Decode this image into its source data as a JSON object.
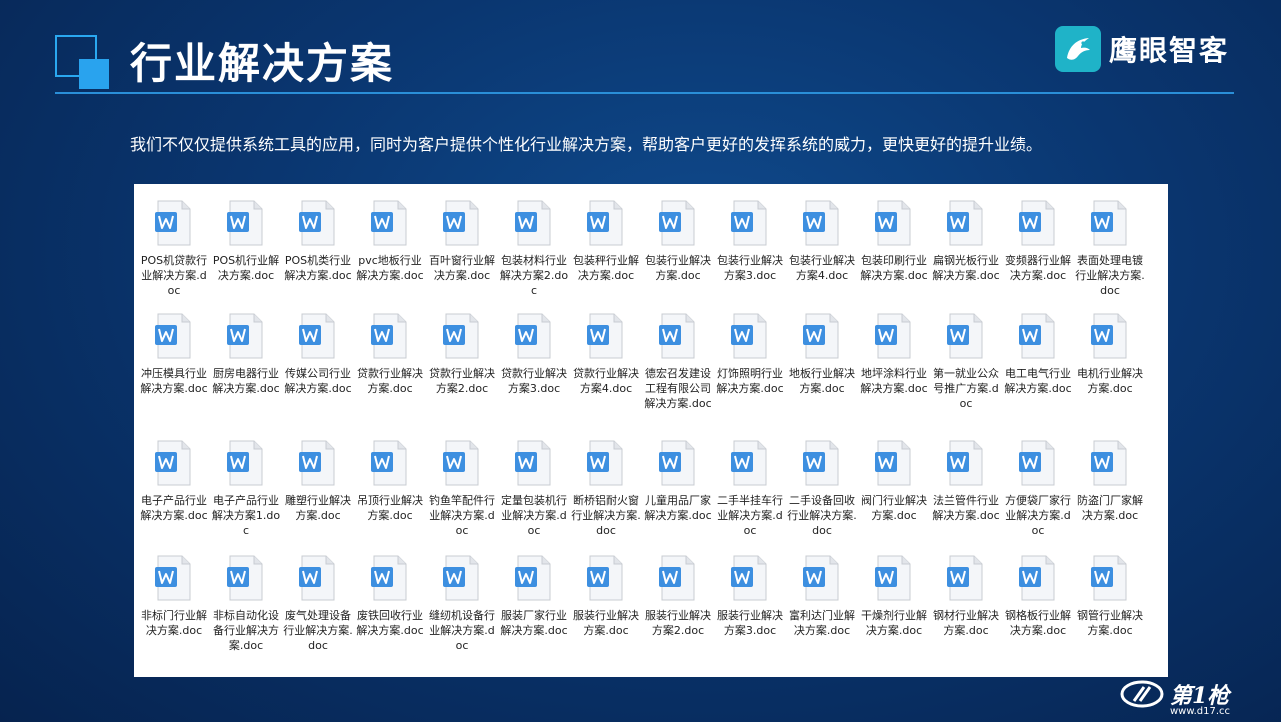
{
  "slide": {
    "title": "行业解决方案",
    "intro": "我们不仅仅提供系统工具的应用，同时为客户提供个性化行业解决方案，帮助客户更好的发挥系统的威力，更快更好的提升业绩。"
  },
  "brand": {
    "name": "鹰眼智客",
    "icon": "eagle-logo-icon",
    "color": "#1fb3c8"
  },
  "watermark": {
    "text": "第1枪",
    "url": "www.d17.cc"
  },
  "colors": {
    "accent": "#2aa8f0",
    "doc_icon": "#3d8fe0"
  },
  "files": [
    [
      "POS机贷款行业解决方案.doc",
      "POS机行业解决方案.doc",
      "POS机类行业解决方案.doc",
      "pvc地板行业解决方案.doc",
      "百叶窗行业解决方案.doc",
      "包装材料行业解决方案2.doc",
      "包装秤行业解决方案.doc",
      "包装行业解决方案.doc",
      "包装行业解决方案3.doc",
      "包装行业解决方案4.doc",
      "包装印刷行业解决方案.doc",
      "扁钢光板行业解决方案.doc",
      "变频器行业解决方案.doc",
      "表面处理电镀行业解决方案.doc"
    ],
    [
      "冲压模具行业解决方案.doc",
      "厨房电器行业解决方案.doc",
      "传媒公司行业解决方案.doc",
      "贷款行业解决方案.doc",
      "贷款行业解决方案2.doc",
      "贷款行业解决方案3.doc",
      "贷款行业解决方案4.doc",
      "德宏召发建设工程有限公司解决方案.doc",
      "灯饰照明行业解决方案.doc",
      "地板行业解决方案.doc",
      "地坪涂料行业解决方案.doc",
      "第一就业公众号推广方案.doc",
      "电工电气行业解决方案.doc",
      "电机行业解决方案.doc"
    ],
    [
      "电子产品行业解决方案.doc",
      "电子产品行业解决方案1.doc",
      "雕塑行业解决方案.doc",
      "吊顶行业解决方案.doc",
      "钓鱼竿配件行业解决方案.doc",
      "定量包装机行业解决方案.doc",
      "断桥铝耐火窗行业解决方案.doc",
      "儿童用品厂家解决方案.doc",
      "二手半挂车行业解决方案.doc",
      "二手设备回收行业解决方案.doc",
      "阀门行业解决方案.doc",
      "法兰管件行业解决方案.doc",
      "方便袋厂家行业解决方案.doc",
      "防盗门厂家解决方案.doc"
    ],
    [
      "非标门行业解决方案.doc",
      "非标自动化设备行业解决方案.doc",
      "废气处理设备行业解决方案.doc",
      "废铁回收行业解决方案.doc",
      "缝纫机设备行业解决方案.doc",
      "服装厂家行业解决方案.doc",
      "服装行业解决方案.doc",
      "服装行业解决方案2.doc",
      "服装行业解决方案3.doc",
      "富利达门业解决方案.doc",
      "干燥剂行业解决方案.doc",
      "钢材行业解决方案.doc",
      "钢格板行业解决方案.doc",
      "钢管行业解决方案.doc"
    ]
  ]
}
